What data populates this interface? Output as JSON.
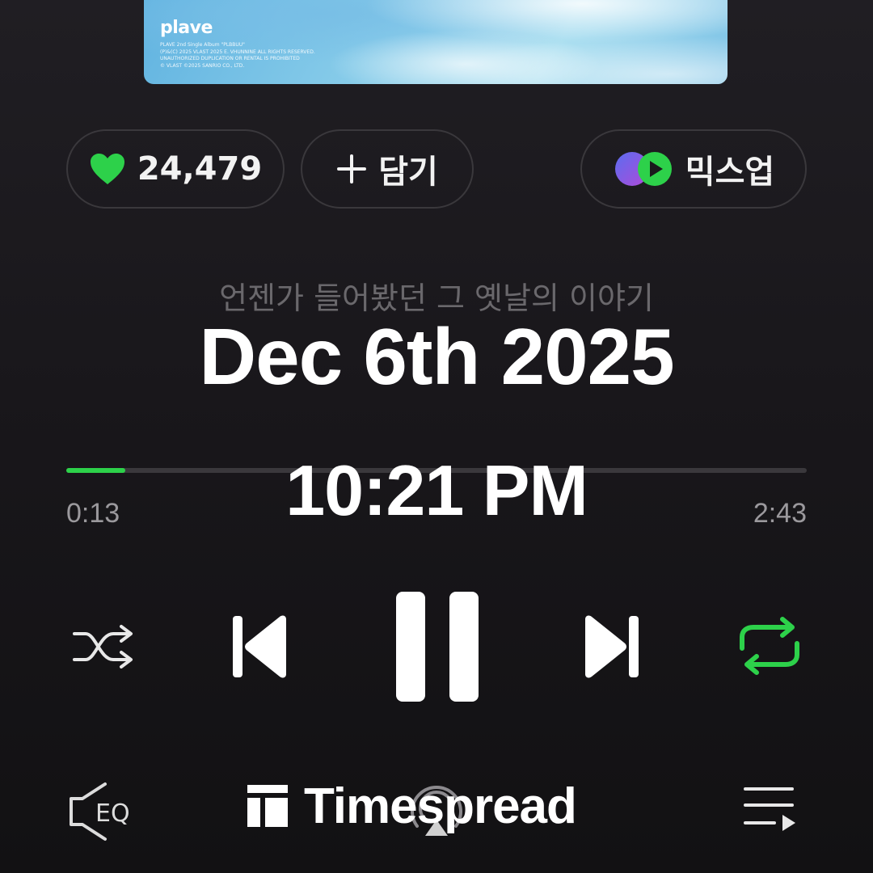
{
  "album": {
    "brand": "plave",
    "fine_print": "PLAVE 2nd Single Album \"PLBBUU\"\n(P)&(C) 2025 VLAST 2025 E. VHUNNINE ALL RIGHTS RESERVED.\nUNAUTHORIZED DUPLICATION OR RENTAL IS PROHIBITED\n© VLAST ©2025 SANRIO CO., LTD."
  },
  "actions": {
    "like_count": "24,479",
    "add_label": "담기",
    "mix_label": "믹스업"
  },
  "lyric": "언젠가 들어봤던 그 옛날의 이야기",
  "overlay": {
    "date": "Dec 6th 2025",
    "time": "10:21 PM"
  },
  "player": {
    "elapsed": "0:13",
    "total": "2:43",
    "progress_fraction": 0.08,
    "accent_color": "#2dd14a"
  },
  "bottom_bar": {
    "eq_label": "EQ",
    "icons": [
      "eq-icon",
      "airplay-icon",
      "queue-icon"
    ]
  },
  "watermark": "Timespread"
}
